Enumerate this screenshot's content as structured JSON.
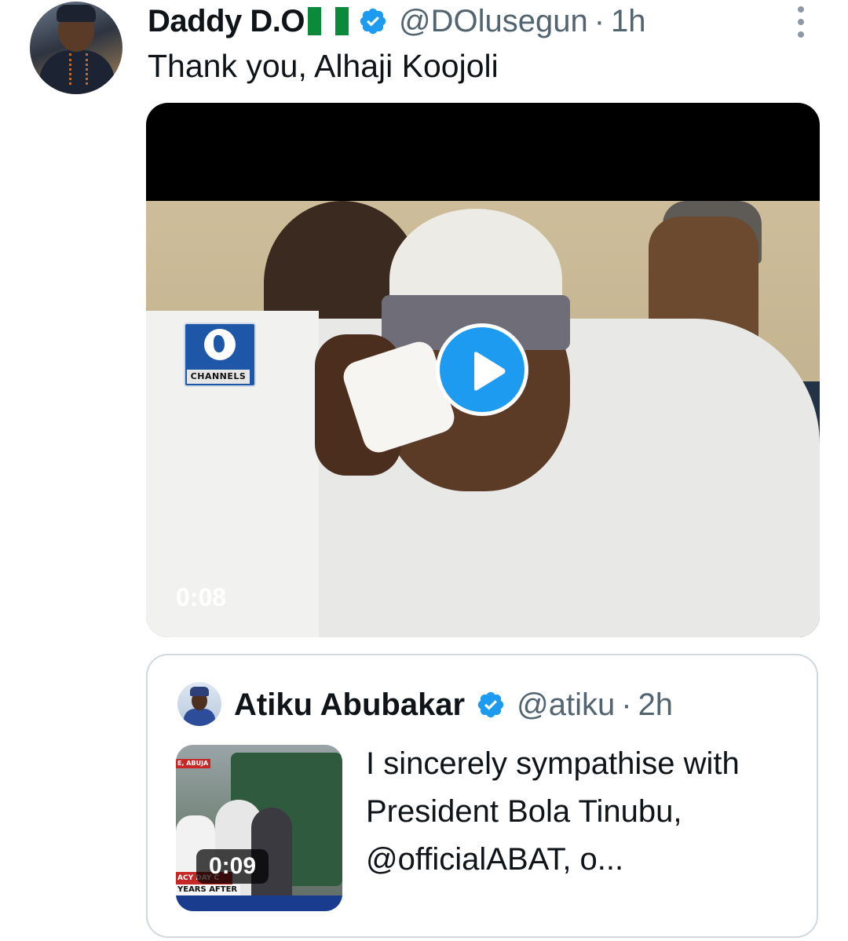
{
  "tweet": {
    "display_name": "Daddy D.O",
    "flag_emoji": "nigeria-flag",
    "verified_color": "#1d9bf0",
    "handle": "@DOlusegun",
    "separator": "·",
    "time": "1h",
    "text": "Thank you, Alhaji Koojoli",
    "video": {
      "duration": "0:08",
      "channel_logo_text": "CHANNELS"
    }
  },
  "quoted_tweet": {
    "display_name": "Atiku Abubakar",
    "handle": "@atiku",
    "separator": "·",
    "time": "2h",
    "text": "I sincerely sympathise with President Bola Tinubu, @officialABAT, o...",
    "thumbnail": {
      "duration": "0:09",
      "tag_text": "E, ABUJA",
      "lower_third_1": "ACY DAY C",
      "lower_third_2": "YEARS AFTER"
    }
  },
  "colors": {
    "accent": "#1d9bf0",
    "secondary_text": "#536471",
    "border": "#cfd9de"
  }
}
